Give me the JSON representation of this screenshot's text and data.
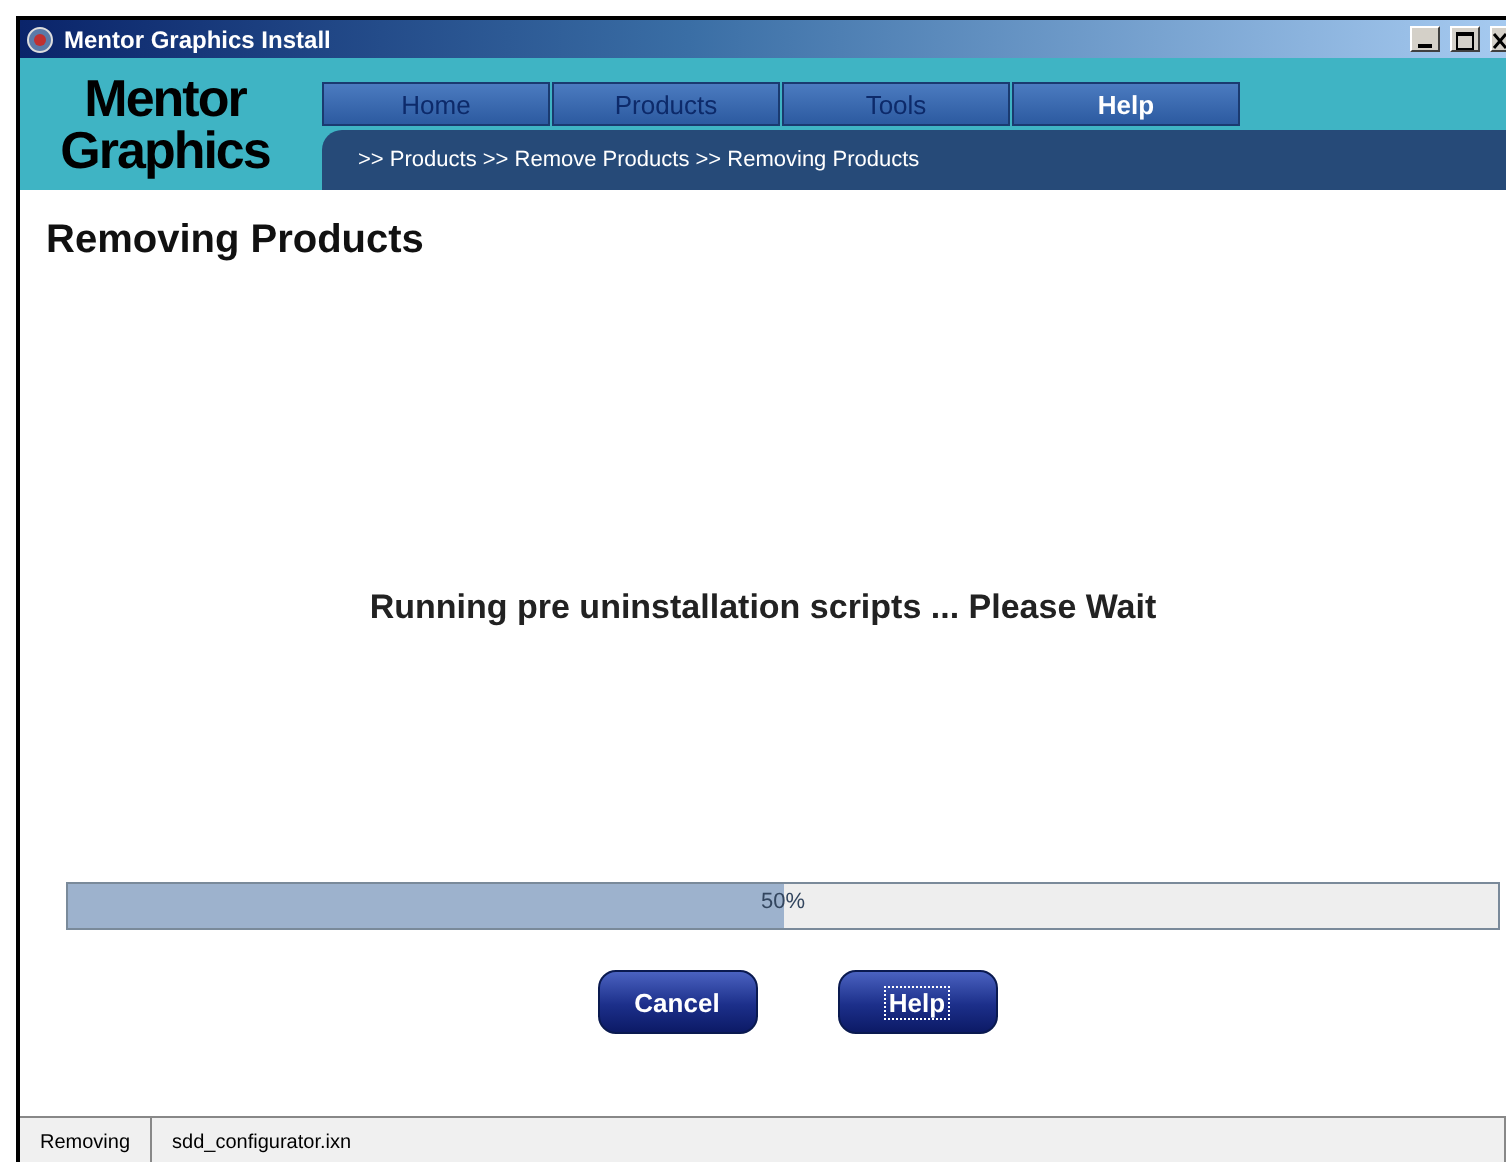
{
  "window": {
    "title": "Mentor Graphics Install"
  },
  "logo": {
    "line_1": "Mentor",
    "line_2": "Graphics"
  },
  "tabs": [
    {
      "label": "Home",
      "selected": false
    },
    {
      "label": "Products",
      "selected": false
    },
    {
      "label": "Tools",
      "selected": false
    },
    {
      "label": "Help",
      "selected": true
    }
  ],
  "breadcrumb": ">> Products >> Remove Products >> Removing Products",
  "page_title": "Removing Products",
  "message": "Running pre uninstallation scripts ... Please Wait",
  "progress": {
    "level": 0.5,
    "reading": "50%"
  },
  "buttons": [
    {
      "label": "Cancel",
      "focused": false
    },
    {
      "label": "Help",
      "focused": true
    }
  ],
  "status_bar": [
    "Removing",
    "sdd_configurator.ixn"
  ]
}
